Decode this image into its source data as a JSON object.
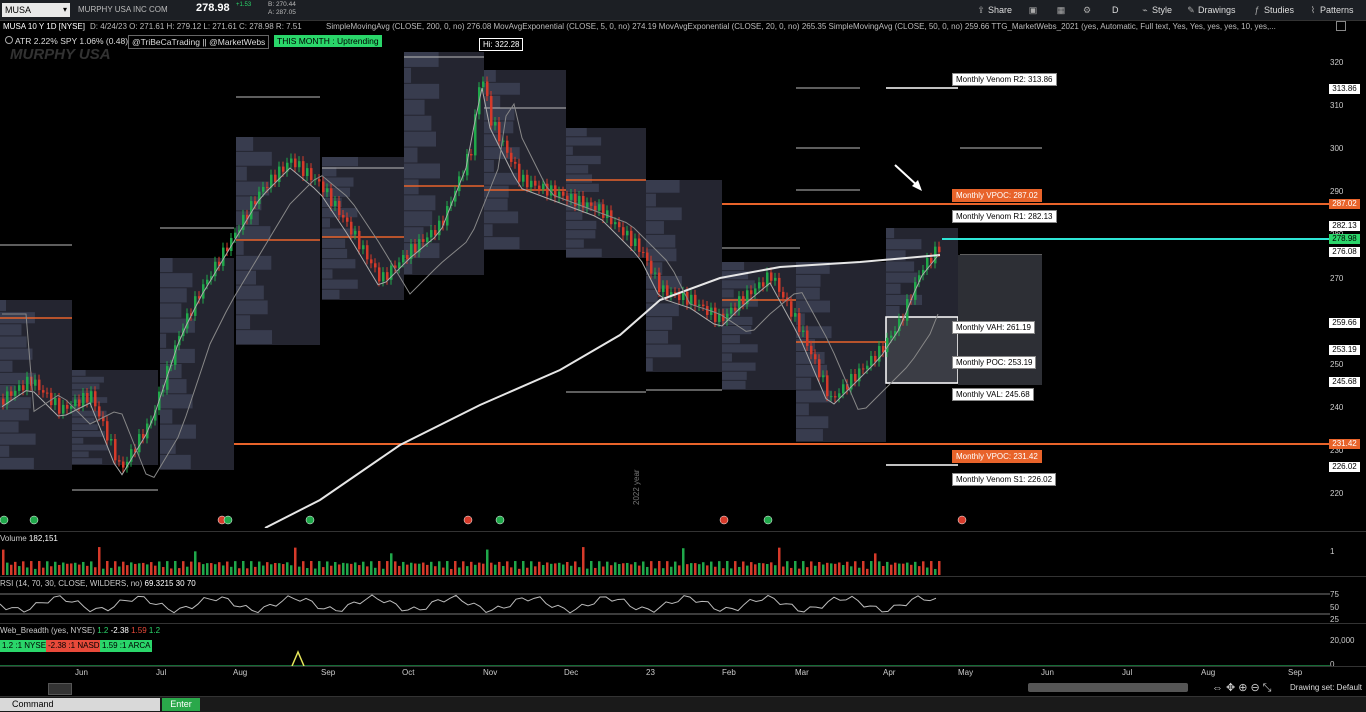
{
  "header": {
    "symbol": "MUSA",
    "company": "MURPHY USA INC COM",
    "last": "278.98",
    "change_small": "+1.53",
    "bid": "B: 270.44",
    "ask": "A: 287.05",
    "quote": "D: 4/24/23   O: 271.61   H: 279.12   L: 271.61   C: 278.98   R: 7.51",
    "studies": "SimpleMovingAvg (CLOSE, 200, 0, no)  276.08   MovAvgExponential (CLOSE, 5, 0, no)  274.19   MovAvgExponential (CLOSE, 20, 0, no)  265.35   SimpleMovingAvg (CLOSE, 50, 0, no)  259.66   TTG_MarketWebs_2021 (yes, Automatic, Full text, Yes, Yes, yes, yes, 10, yes,...",
    "title": "MUSA 10 Y 1D [NYSE]"
  },
  "toolbar": {
    "share": "Share",
    "d": "D",
    "style": "Style",
    "drawings": "Drawings",
    "studies": "Studies",
    "patterns": "Patterns"
  },
  "pills": {
    "atr": "ATR 2.22% SPY 1.06% (0.48)",
    "handle": "@TriBeCaTrading || @MarketWebs",
    "month": "THIS MONTH : Uptrending"
  },
  "watermark": "MURPHY USA",
  "hi_label": "Hi: 322.28",
  "levels": {
    "r2": "Monthly Venom R2: 313.86",
    "vpoc_hi": "Monthly VPOC: 287.02",
    "r1": "Monthly Venom R1: 282.13",
    "vah": "Monthly VAH: 261.19",
    "poc": "Monthly POC: 253.19",
    "val": "Monthly VAL: 245.68",
    "vpoc_lo": "Monthly VPOC: 231.42",
    "s1": "Monthly Venom S1: 226.02"
  },
  "yaxis": [
    "320",
    "310",
    "300",
    "290",
    "280",
    "270",
    "260",
    "250",
    "240",
    "230",
    "220"
  ],
  "price_tags": [
    {
      "text": "313.86",
      "bg": "#ffffff"
    },
    {
      "text": "287.02",
      "bg": "#e8632a"
    },
    {
      "text": "282.13",
      "bg": "#ffffff"
    },
    {
      "text": "278.98",
      "bg": "#2ad66a"
    },
    {
      "text": "276.08",
      "bg": "#ffffff"
    },
    {
      "text": "259.66",
      "bg": "#ffffff"
    },
    {
      "text": "253.19",
      "bg": "#ffffff"
    },
    {
      "text": "245.68",
      "bg": "#ffffff"
    },
    {
      "text": "231.42",
      "bg": "#e8632a"
    },
    {
      "text": "226.02",
      "bg": "#ffffff"
    }
  ],
  "xaxis": [
    "Jun",
    "Jul",
    "Aug",
    "Sep",
    "Oct",
    "Nov",
    "Dec",
    "23",
    "Feb",
    "Mar",
    "Apr",
    "May",
    "Jun",
    "Jul",
    "Aug",
    "Sep"
  ],
  "year_marker": "2022 year",
  "volume": {
    "label": "Volume",
    "value": "182,151",
    "scale": "1"
  },
  "rsi": {
    "label": "RSI (14, 70, 30, CLOSE, WILDERS, no)",
    "value": "69.3215",
    "ob": "30",
    "os": "70",
    "scale": [
      "75",
      "50",
      "25"
    ]
  },
  "breadth": {
    "label": "Web_Breadth (yes, NYSE)",
    "v1": "1.2",
    "v2": "-2.38",
    "v3": "1.59",
    "v4": "1.2",
    "nyse": "1.2 :1 NYSE",
    "nasd": "-2.38 :1 NASD",
    "arca": "1.59 :1 ARCA",
    "scale": [
      "20,000",
      "0"
    ]
  },
  "command": {
    "placeholder": "Command",
    "enter": "Enter"
  },
  "drawing_set": "Drawing set: Default",
  "colors": {
    "up": "#1fa84a",
    "down": "#d63a2a",
    "orange": "#e8632a",
    "cyan": "#2ee6d6",
    "sma200": "#e6e6e6"
  }
}
